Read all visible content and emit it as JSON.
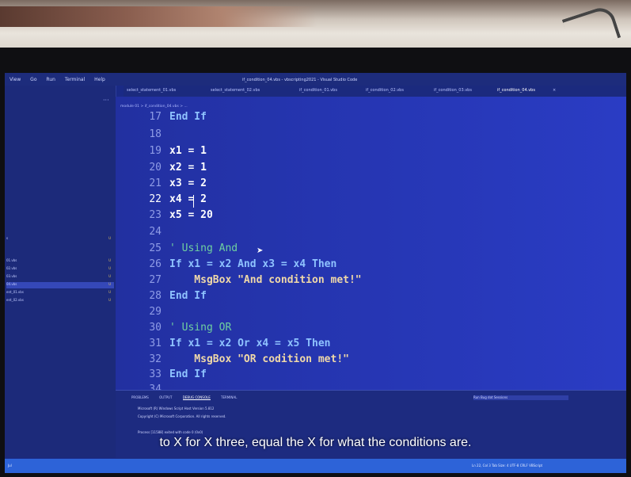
{
  "window": {
    "title": "if_condition_04.vbs - vbscripting2021 - Visual Studio Code",
    "menu": [
      "View",
      "Go",
      "Run",
      "Terminal",
      "Help"
    ]
  },
  "tabs": [
    {
      "label": "select_statement_01.vbs",
      "active": false
    },
    {
      "label": "select_statement_02.vbs",
      "active": false
    },
    {
      "label": "if_condition_01.vbs",
      "active": false
    },
    {
      "label": "if_condition_02.vbs",
      "active": false
    },
    {
      "label": "if_condition_03.vbs",
      "active": false
    },
    {
      "label": "if_condition_04.vbs",
      "active": true
    }
  ],
  "breadcrumb": "module 01 > if_condition_04.vbs > ...",
  "sidebar": {
    "more": "···",
    "files": [
      {
        "label": "s",
        "mark": "U"
      },
      {
        "label": "01.vbs",
        "mark": "U"
      },
      {
        "label": "02.vbs",
        "mark": "U"
      },
      {
        "label": "03.vbs",
        "mark": "U"
      },
      {
        "label": "04.vbs",
        "mark": "U",
        "active": true
      },
      {
        "label": "ent_01.vbs",
        "mark": "U"
      },
      {
        "label": "ent_02.vbs",
        "mark": "U"
      }
    ]
  },
  "code_lines": [
    {
      "n": "17",
      "text": "End If"
    },
    {
      "n": "18",
      "text": ""
    },
    {
      "n": "19",
      "text": "x1 = 1"
    },
    {
      "n": "20",
      "text": "x2 = 1"
    },
    {
      "n": "21",
      "text": "x3 = 2"
    },
    {
      "n": "22",
      "text": "x4 = 2"
    },
    {
      "n": "23",
      "text": "x5 = 20"
    },
    {
      "n": "24",
      "text": ""
    },
    {
      "n": "25",
      "text": "' Using And"
    },
    {
      "n": "26",
      "text": "If x1 = x2 And x3 = x4 Then"
    },
    {
      "n": "27",
      "text": "    MsgBox \"And condition met!\""
    },
    {
      "n": "28",
      "text": "End If"
    },
    {
      "n": "29",
      "text": ""
    },
    {
      "n": "30",
      "text": "' Using OR"
    },
    {
      "n": "31",
      "text": "If x1 = x2 Or x4 = x5 Then"
    },
    {
      "n": "32",
      "text": "    MsgBox \"OR codition met!\""
    },
    {
      "n": "33",
      "text": "End If"
    },
    {
      "n": "34",
      "text": ""
    }
  ],
  "panel": {
    "tabs": [
      "PROBLEMS",
      "OUTPUT",
      "DEBUG CONSOLE",
      "TERMINAL"
    ],
    "selected_tab": "DEBUG CONSOLE",
    "terminal_selector": "Run Bug dot Sessions",
    "lines": [
      "Microsoft (R) Windows Script Host Version 5.812",
      "Copyright (C) Microsoft Corporation. All rights reserved.",
      "",
      "Process [11588] exited with code 0 (0x0)"
    ]
  },
  "statusbar": {
    "left": "Jul",
    "right": "Ln 22, Col 3   Tab Size: 4   UTF-8   CRLF   VBScript"
  },
  "caption": "to X for X three, equal the X for what the conditions are."
}
